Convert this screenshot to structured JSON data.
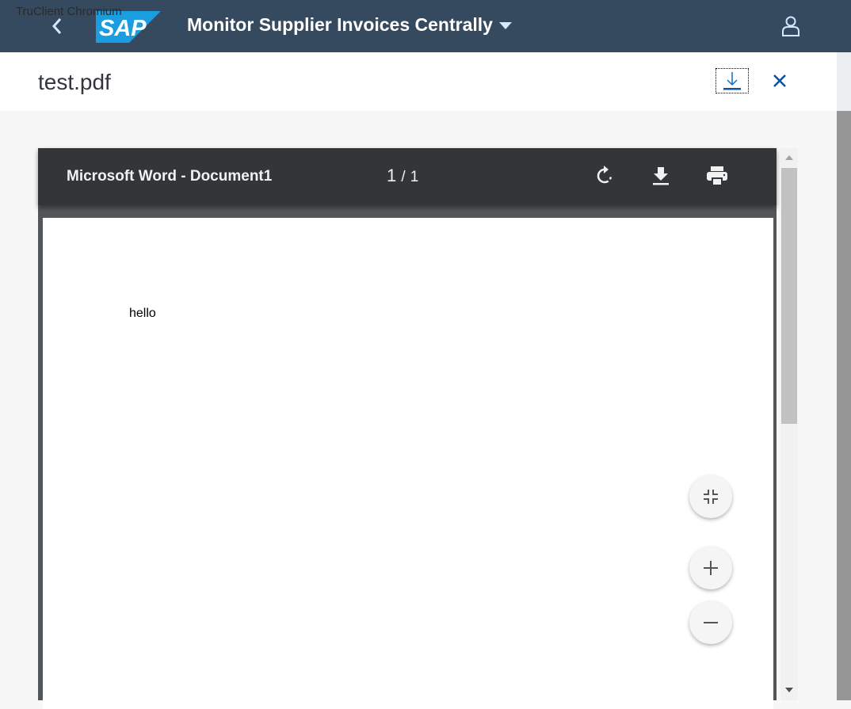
{
  "watermark": "TruClient Chromium",
  "shell": {
    "title": "Monitor Supplier Invoices Centrally",
    "logo": "SAP"
  },
  "header": {
    "file_name": "test.pdf"
  },
  "viewer": {
    "doc_title": "Microsoft Word - Document1",
    "page_current": "1",
    "page_total": "1",
    "page_sep": "/",
    "content": "hello"
  },
  "colors": {
    "shell": "#354a5f",
    "accent": "#0a6ed1",
    "viewer_bar": "#323639"
  }
}
